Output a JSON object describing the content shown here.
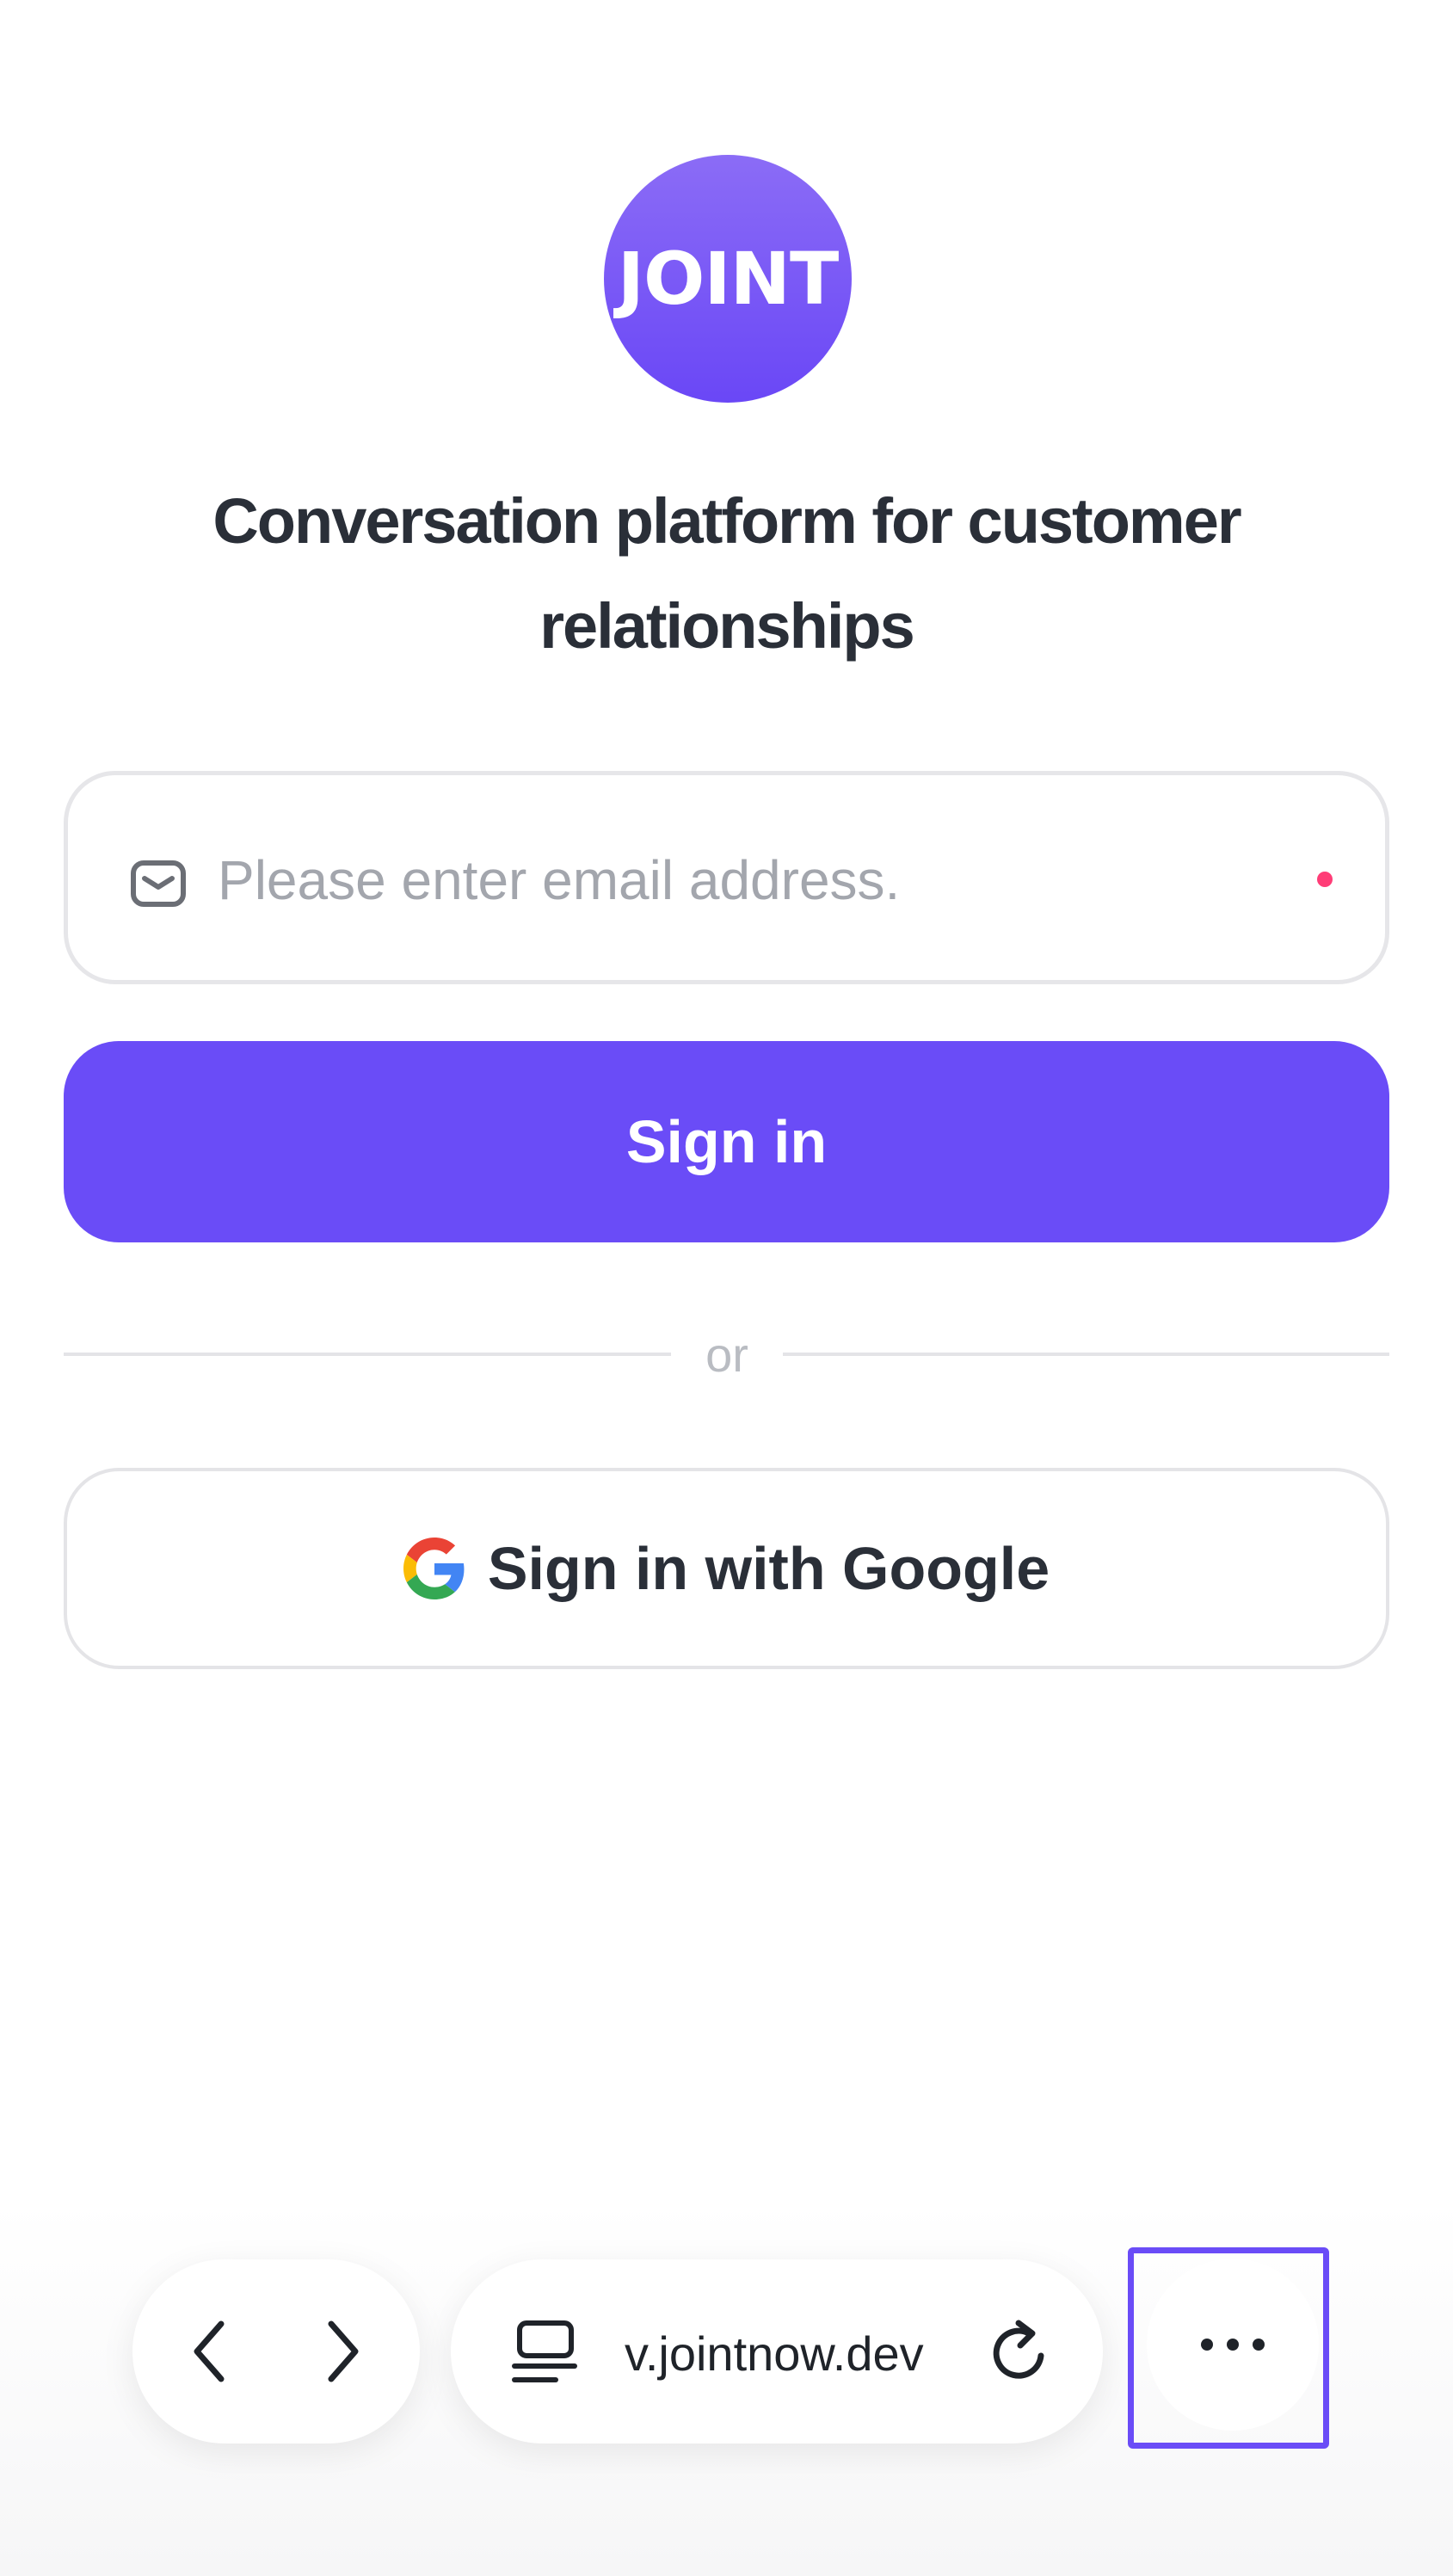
{
  "logo": {
    "text": "JOINT",
    "color": "#6a47f6"
  },
  "headline": "Conversation platform for customer relationships",
  "email": {
    "placeholder": "Please enter email address.",
    "value": "",
    "icon": "mail-icon",
    "required_color": "#ff3d77"
  },
  "signin": {
    "label": "Sign in",
    "color": "#6a4cf7"
  },
  "divider": {
    "label": "or"
  },
  "google": {
    "label": "Sign in with Google",
    "icon": "google-icon"
  },
  "browser_toolbar": {
    "back_icon": "chevron-left-icon",
    "forward_icon": "chevron-right-icon",
    "tab_icon": "tab-overview-icon",
    "url": "v.jointnow.dev",
    "reload_icon": "reload-icon",
    "more_icon": "more-horizontal-icon",
    "highlight_color": "#6a4cf7"
  }
}
